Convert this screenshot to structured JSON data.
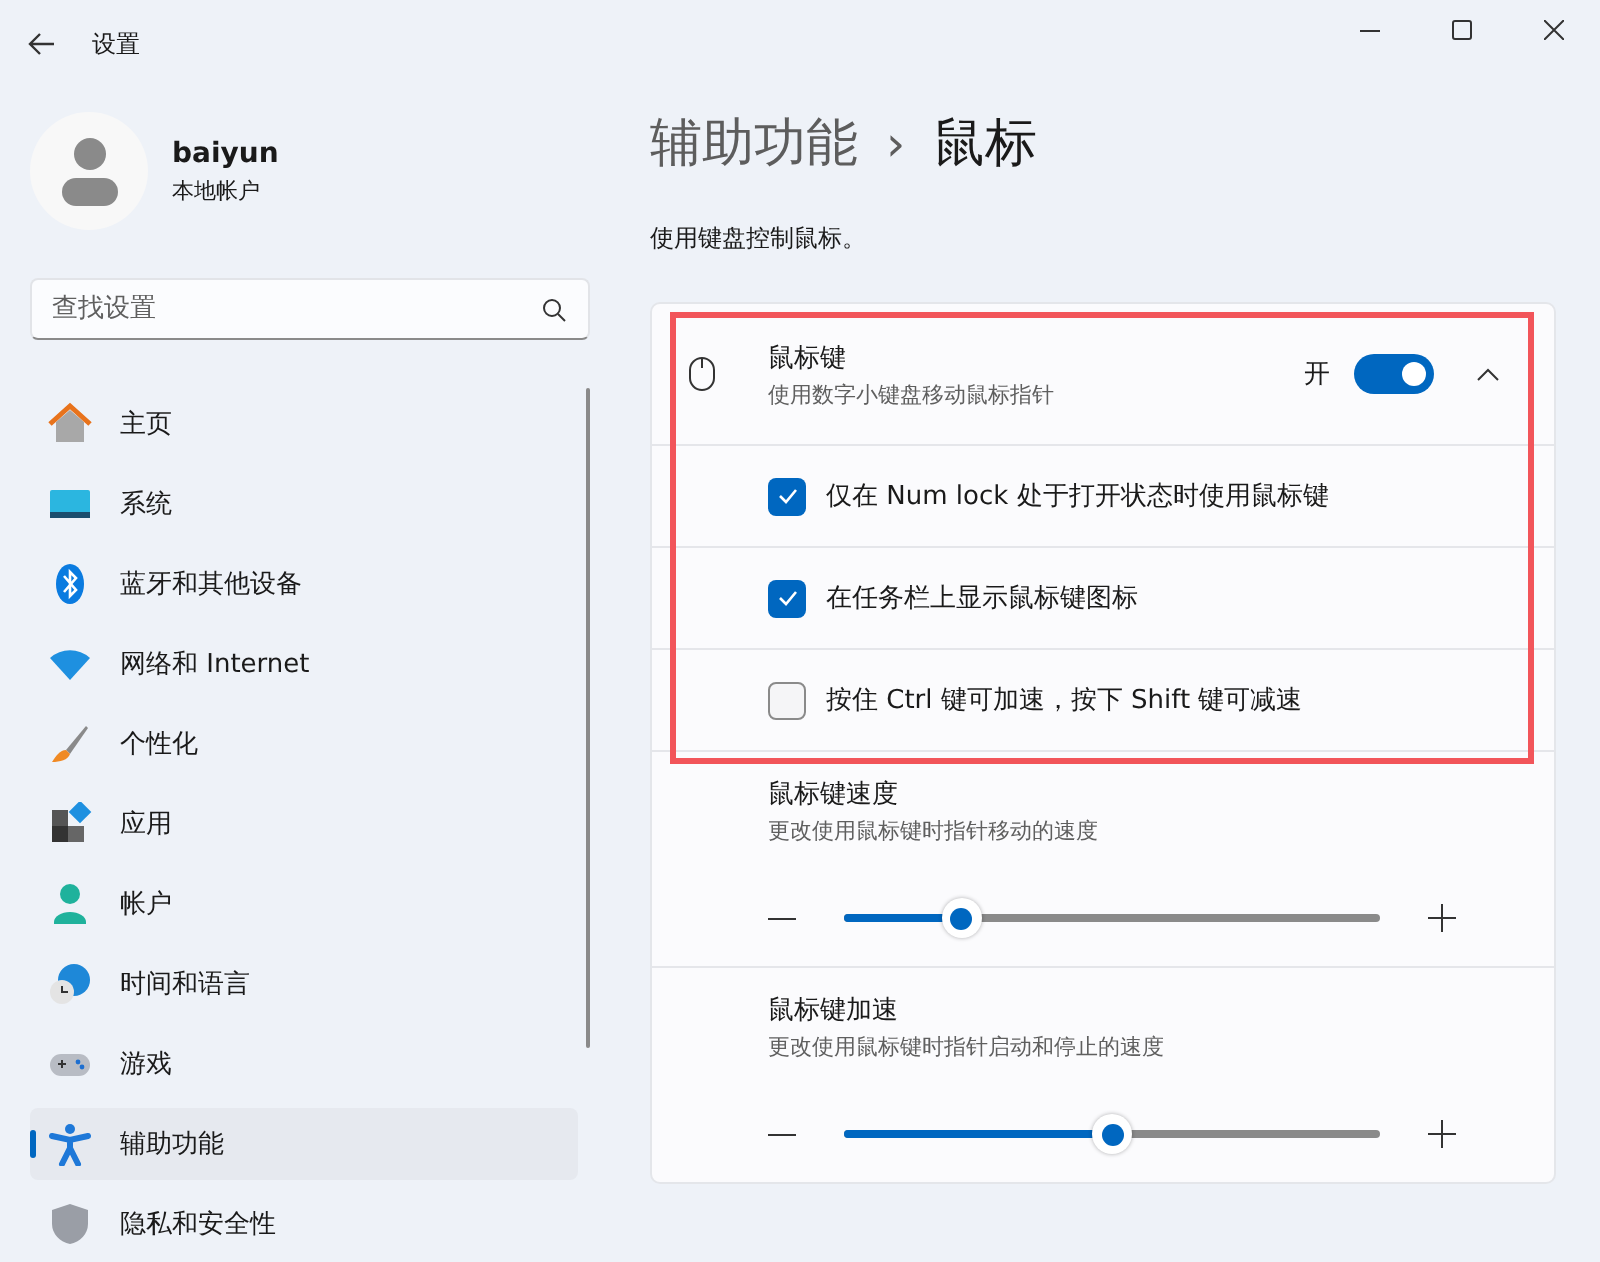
{
  "window": {
    "title": "设置"
  },
  "profile": {
    "name": "baiyun",
    "account_type": "本地帐户"
  },
  "search": {
    "placeholder": "查找设置"
  },
  "nav": [
    {
      "label": "主页",
      "kind": "home",
      "selected": false
    },
    {
      "label": "系统",
      "kind": "system",
      "selected": false
    },
    {
      "label": "蓝牙和其他设备",
      "kind": "bluetooth",
      "selected": false
    },
    {
      "label": "网络和 Internet",
      "kind": "wifi",
      "selected": false
    },
    {
      "label": "个性化",
      "kind": "brush",
      "selected": false
    },
    {
      "label": "应用",
      "kind": "apps",
      "selected": false
    },
    {
      "label": "帐户",
      "kind": "person",
      "selected": false
    },
    {
      "label": "时间和语言",
      "kind": "globe",
      "selected": false
    },
    {
      "label": "游戏",
      "kind": "gamepad",
      "selected": false
    },
    {
      "label": "辅助功能",
      "kind": "accessibility",
      "selected": true
    },
    {
      "label": "隐私和安全性",
      "kind": "shield",
      "selected": false
    }
  ],
  "breadcrumb": {
    "parent": "辅助功能",
    "separator": "›",
    "current": "鼠标"
  },
  "description": "使用键盘控制鼠标。",
  "mouse_keys": {
    "title": "鼠标键",
    "subtitle": "使用数字小键盘移动鼠标指针",
    "state_label": "开",
    "on": true,
    "expanded": true,
    "highlighted": true,
    "options": [
      {
        "label": "仅在 Num lock 处于打开状态时使用鼠标键",
        "checked": true
      },
      {
        "label": "在任务栏上显示鼠标键图标",
        "checked": true
      },
      {
        "label": "按住 Ctrl 键可加速，按下 Shift 键可减速",
        "checked": false
      }
    ]
  },
  "sliders": [
    {
      "title": "鼠标键速度",
      "subtitle": "更改使用鼠标键时指针移动的速度",
      "level": 0.22
    },
    {
      "title": "鼠标键加速",
      "subtitle": "更改使用鼠标键时指针启动和停止的速度",
      "level": 0.5
    }
  ]
}
